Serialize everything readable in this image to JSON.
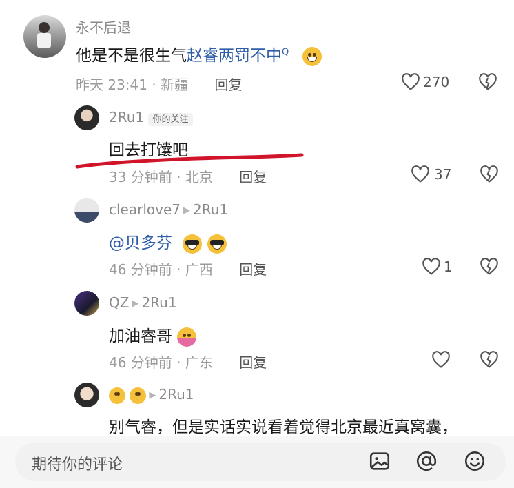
{
  "comments": [
    {
      "username": "永不后退",
      "text_plain": "他是不是很生气",
      "text_link": "赵睿两罚不中",
      "search_mark": "Q",
      "time": "昨天 23:41",
      "location": "新疆",
      "reply_label": "回复",
      "like_count": "270"
    },
    {
      "username": "2Ru1",
      "tag": "你的关注",
      "text": "回去打馕吧",
      "time": "33 分钟前",
      "location": "北京",
      "reply_label": "回复",
      "like_count": "37"
    },
    {
      "username": "clearlove7",
      "reply_to": "2Ru1",
      "text": "@贝多芬",
      "time": "46 分钟前",
      "location": "广西",
      "reply_label": "回复",
      "like_count": "1"
    },
    {
      "username": "QZ",
      "reply_to": "2Ru1",
      "text": "加油睿哥",
      "time": "46 分钟前",
      "location": "广东",
      "reply_label": "回复"
    },
    {
      "reply_to": "2Ru1",
      "text": "别气睿，但是实话实说看着觉得北京最近真窝囊，"
    }
  ],
  "input": {
    "placeholder": "期待你的评论"
  },
  "icons": [
    "image-icon",
    "at-icon",
    "emoji-icon",
    "heart-icon",
    "broken-heart-icon"
  ],
  "colors": {
    "link": "#2f5ea8",
    "underline": "#d0142a",
    "meta": "#9a9a9a"
  }
}
